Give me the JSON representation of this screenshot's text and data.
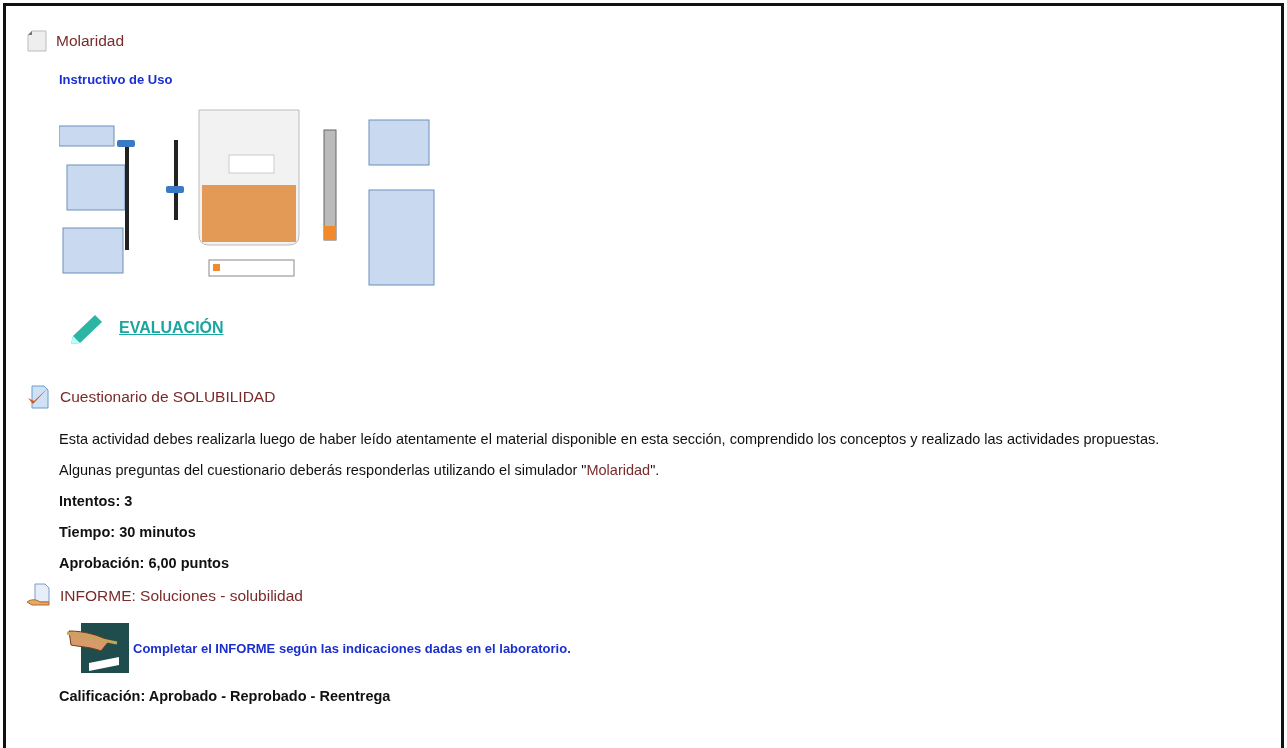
{
  "sections": [
    {
      "kind": "page",
      "title": "Molaridad",
      "content": [
        {
          "kind": "link",
          "text": "Instructivo de Uso"
        },
        {
          "kind": "simulator"
        },
        {
          "kind": "evaluation",
          "text": "EVALUACIÓN"
        }
      ]
    },
    {
      "kind": "quiz",
      "title": "Cuestionario de SOLUBILIDAD",
      "content": [
        {
          "kind": "paragraph",
          "text": "Esta actividad debes realizarla luego de haber leído atentamente el material disponible en esta sección, comprendido los conceptos  y realizado las actividades propuestas."
        },
        {
          "kind": "paragraph_link",
          "before": "Algunas preguntas del cuestionario deberás responderlas utilizando el simulador \"",
          "link": "Molaridad",
          "after": "\"."
        },
        {
          "kind": "bold",
          "text": "Intentos: 3"
        },
        {
          "kind": "bold",
          "text": "Tiempo: 30 minutos"
        },
        {
          "kind": "bold",
          "text": "Aprobación: 6,00 puntos"
        }
      ]
    },
    {
      "kind": "assignment",
      "title": "INFORME: Soluciones - solubilidad",
      "content": [
        {
          "kind": "image_link",
          "text": "Completar el INFORME según las indicaciones dadas en el laboratorio."
        },
        {
          "kind": "bold",
          "text": "Calificación: Aprobado - Reprobado - Reentrega"
        }
      ]
    }
  ]
}
